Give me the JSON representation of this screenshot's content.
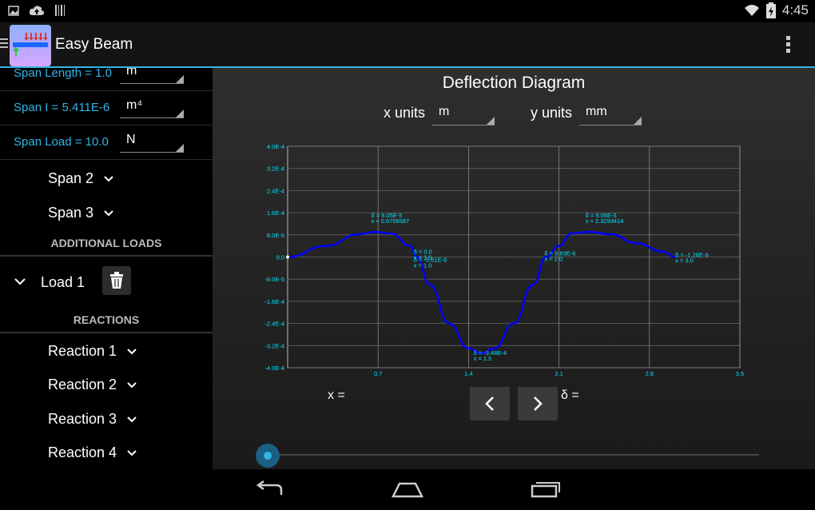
{
  "app": {
    "title": "Easy Beam"
  },
  "status": {
    "time": "4:45"
  },
  "properties": [
    {
      "label": "Span Length = 1.0",
      "unit": "m"
    },
    {
      "label": "Span I = 5.411E-6",
      "unit": "m⁴"
    },
    {
      "label": "Span Load = 10.0",
      "unit": "N"
    }
  ],
  "spans": [
    "Span 2",
    "Span 3"
  ],
  "sections": {
    "additional_loads": "ADDITIONAL LOADS",
    "reactions": "REACTIONS"
  },
  "loads": [
    "Load 1"
  ],
  "reactions": [
    "Reaction 1",
    "Reaction 2",
    "Reaction 3",
    "Reaction 4"
  ],
  "diagram": {
    "title": "Deflection Diagram",
    "x_units_label": "x units",
    "x_units_value": "m",
    "y_units_label": "y units",
    "y_units_value": "mm",
    "x_equals": "x =",
    "delta_equals": "δ ="
  },
  "colors": {
    "accent": "#33b5e5",
    "curve": "#0000ff",
    "annotation": "#00e5ff"
  },
  "chart_data": {
    "type": "line",
    "title": "",
    "xlabel": "",
    "ylabel": "",
    "xlim": [
      0,
      3.5
    ],
    "ylim": [
      -0.0004,
      0.0004
    ],
    "x_ticks": [
      "0.7",
      "1.4",
      "2.1",
      "2.8",
      "3.5"
    ],
    "x_tick_values": [
      0.7,
      1.4,
      2.1,
      2.8,
      3.5
    ],
    "y_ticks": [
      "4.0E-4",
      "3.2E-4",
      "2.4E-4",
      "1.6E-4",
      "8.0E-5",
      "0.0",
      "-8.0E-5",
      "-1.6E-4",
      "-2.4E-4",
      "-3.2E-4",
      "-4.0E-4"
    ],
    "y_tick_values": [
      0.0004,
      0.00032,
      0.00024,
      0.00016,
      8e-05,
      0,
      -8e-05,
      -0.00016,
      -0.00024,
      -0.00032,
      -0.0004
    ],
    "grid": true,
    "series": [
      {
        "x": [
          0,
          0.3,
          0.55,
          0.67,
          0.8,
          0.95,
          1.0,
          1.1,
          1.25,
          1.4,
          1.5,
          1.6,
          1.75,
          1.9,
          2.0,
          2.1,
          2.2,
          2.33,
          2.5,
          2.7,
          2.9,
          3.0
        ],
        "y": [
          0,
          4e-05,
          8.2e-05,
          9.05e-05,
          8.5e-05,
          4e-05,
          0,
          -0.0001,
          -0.00024,
          -0.00033,
          -0.000348,
          -0.00033,
          -0.00024,
          -0.0001,
          0,
          4e-05,
          8.5e-05,
          9.06e-05,
          8.2e-05,
          5e-05,
          2e-05,
          0
        ]
      }
    ],
    "annotations": [
      {
        "lines": [
          "δ = 9.05E-5",
          "x = 0.6706587"
        ],
        "x": 0.6706587,
        "y": 9.05e-05
      },
      {
        "lines": [
          "δ = 0.0",
          "x = 1.0"
        ],
        "x": 1.0,
        "y": 0.0
      },
      {
        "lines": [
          "δ = -5.61E-9",
          "x = 1.0"
        ],
        "x": 1.0,
        "y": -5.6e-09
      },
      {
        "lines": [
          "δ = -3.48E-4",
          "x = 1.5"
        ],
        "x": 1.5,
        "y": -0.000348
      },
      {
        "lines": [
          "δ = 9.06E-5",
          "x = 2.3293414"
        ],
        "x": 2.3293414,
        "y": 9.06e-05
      },
      {
        "lines": [
          "δ = 9.83E-6",
          "x = 2.0"
        ],
        "x": 2.0,
        "y": 0.0
      },
      {
        "lines": [
          "δ = -1.28E-9",
          "x = 3.0"
        ],
        "x": 3.0,
        "y": 0.0
      }
    ]
  }
}
